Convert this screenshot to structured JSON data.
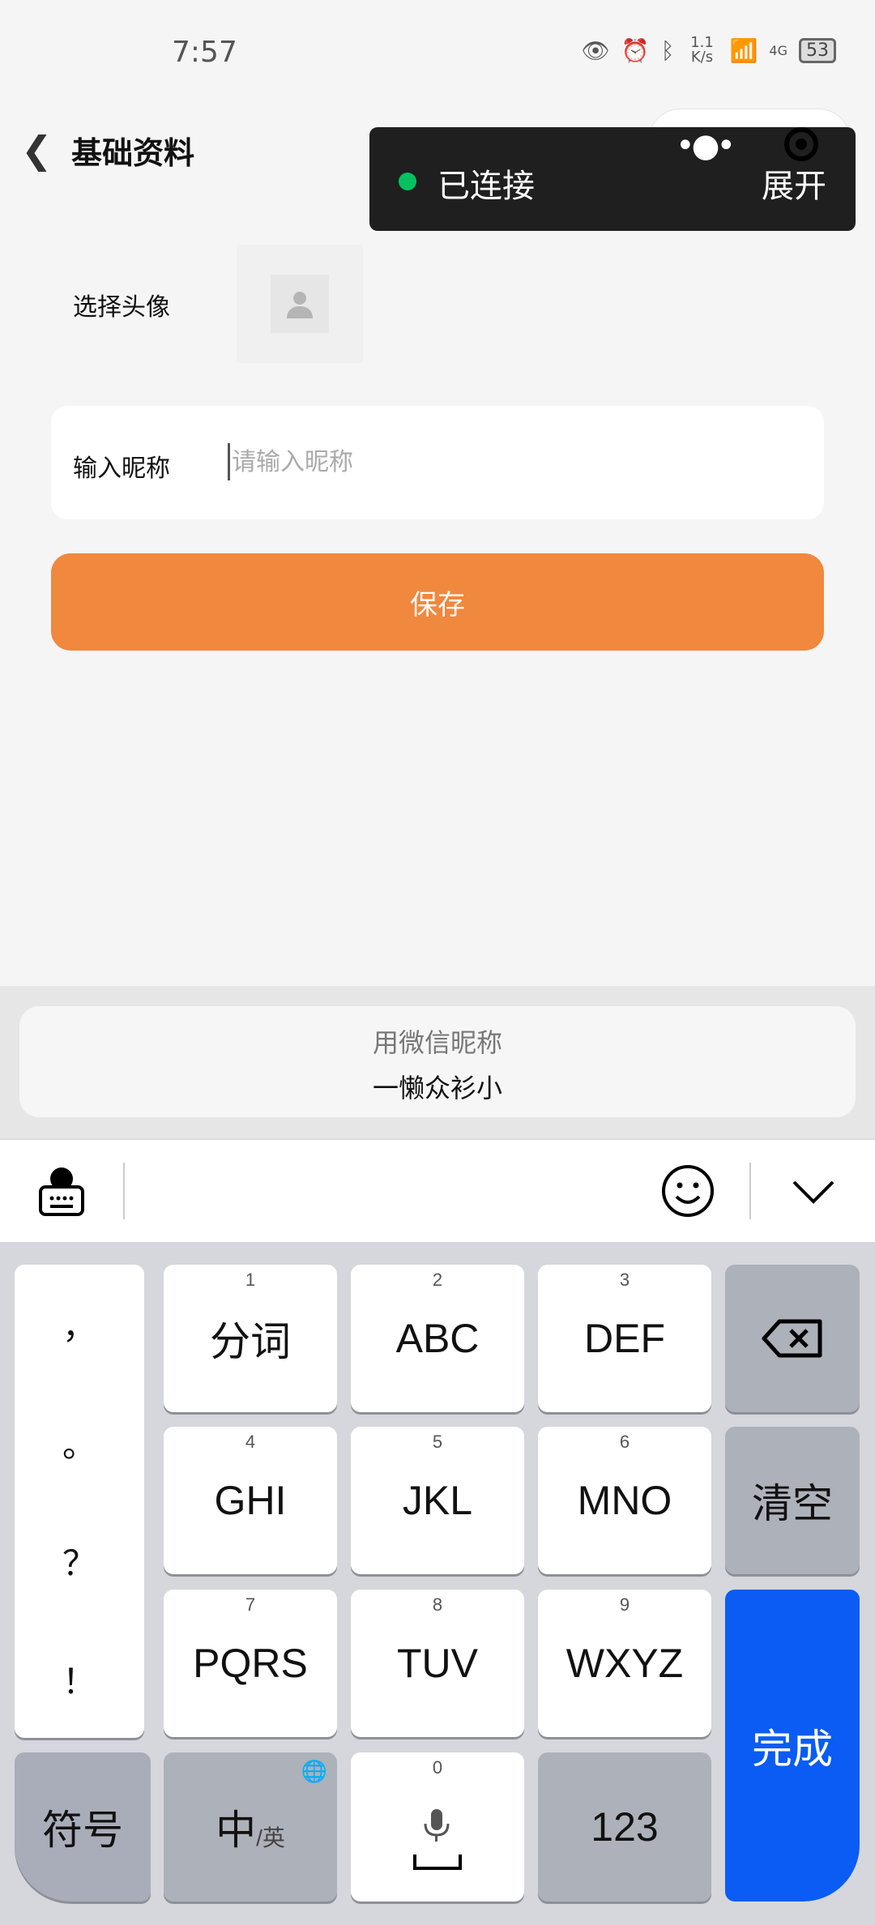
{
  "status_bar": {
    "time": "7:57",
    "net_speed": "1.1 K/s",
    "network": "4G",
    "battery": "53"
  },
  "nav": {
    "title": "基础资料"
  },
  "overlay": {
    "status": "已连接",
    "expand": "展开",
    "status_color": "#07c160"
  },
  "form": {
    "avatar_label": "选择头像",
    "nickname_label": "输入昵称",
    "nickname_placeholder": "请输入昵称",
    "nickname_value": "",
    "save": "保存",
    "save_color": "#f0883e"
  },
  "suggestion": {
    "title": "用微信昵称",
    "name": "一懒众衫小"
  },
  "keyboard": {
    "punct": [
      "，",
      "。",
      "？",
      "！"
    ],
    "keys": [
      {
        "hint": "1",
        "label": "分词"
      },
      {
        "hint": "2",
        "label": "ABC"
      },
      {
        "hint": "3",
        "label": "DEF"
      },
      {
        "hint": "4",
        "label": "GHI"
      },
      {
        "hint": "5",
        "label": "JKL"
      },
      {
        "hint": "6",
        "label": "MNO"
      },
      {
        "hint": "7",
        "label": "PQRS"
      },
      {
        "hint": "8",
        "label": "TUV"
      },
      {
        "hint": "9",
        "label": "WXYZ"
      }
    ],
    "clear": "清空",
    "done": "完成",
    "symbols": "符号",
    "lang_main": "中",
    "lang_sub": "/英",
    "space_hint": "0",
    "numbers": "123",
    "done_color": "#0a5cf5"
  }
}
